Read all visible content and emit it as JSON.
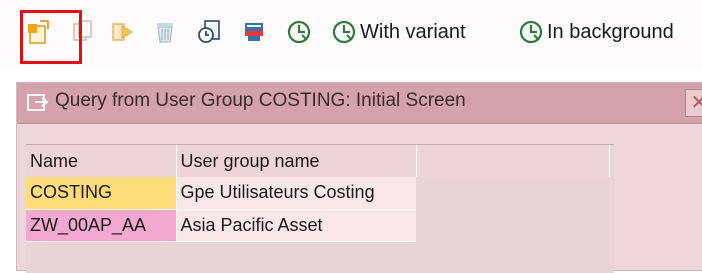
{
  "toolbar": {
    "buttons": [
      {
        "icon": "create-new-icon",
        "label": ""
      },
      {
        "icon": "copy-icon",
        "label": ""
      },
      {
        "icon": "rename-icon",
        "label": ""
      },
      {
        "icon": "delete-icon",
        "label": ""
      },
      {
        "icon": "change-group-icon",
        "label": ""
      },
      {
        "icon": "description-icon",
        "label": ""
      },
      {
        "icon": "execute-icon",
        "label": ""
      },
      {
        "icon": "execute-variant-icon",
        "label": "With variant"
      },
      {
        "icon": "execute-background-icon",
        "label": "In background"
      }
    ]
  },
  "dialog": {
    "title": "Query from User Group COSTING: Initial Screen",
    "close_symbol": "✕"
  },
  "table": {
    "headers": [
      "Name",
      "User group name"
    ],
    "rows": [
      {
        "name": "COSTING",
        "group": "Gpe Utilisateurs Costing"
      },
      {
        "name": "ZW_00AP_AA",
        "group": "Asia Pacific Asset"
      }
    ]
  },
  "colors": {
    "highlight_box": "#e0101a",
    "title_bar": "#d4a2aa",
    "row_selected_key": "#ffdc7a",
    "row_key": "#f3a8cf"
  }
}
